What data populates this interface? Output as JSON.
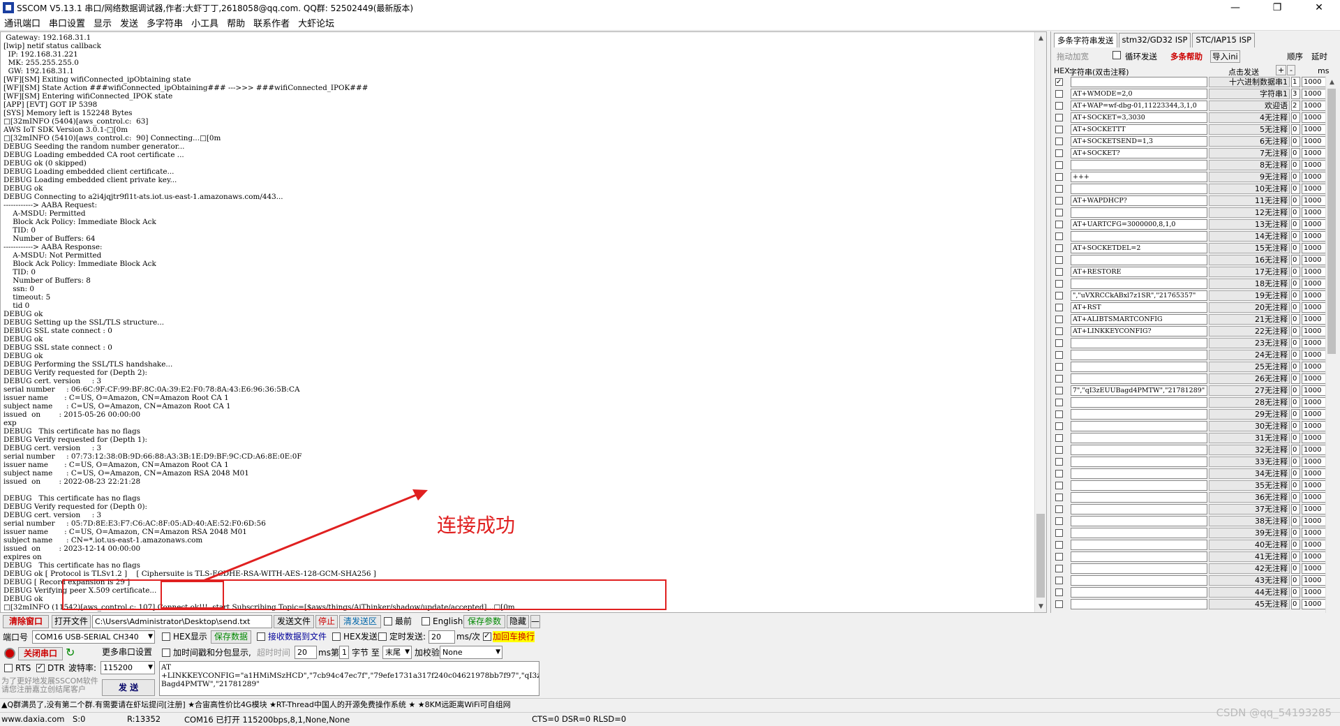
{
  "window": {
    "title": "SSCOM V5.13.1 串口/网络数据调试器,作者:大虾丁丁,2618058@qq.com. QQ群: 52502449(最新版本)",
    "minimize": "—",
    "maximize": "❐",
    "close": "✕"
  },
  "menu": [
    "通讯端口",
    "串口设置",
    "显示",
    "发送",
    "多字符串",
    "小工具",
    "帮助",
    "联系作者",
    "大虾论坛"
  ],
  "log": {
    "text": " Gateway: 192.168.31.1\n[lwip] netif status callback\n  IP: 192.168.31.221\n  MK: 255.255.255.0\n  GW: 192.168.31.1\n[WF][SM] Exiting wifiConnected_ipObtaining state\n[WF][SM] State Action ###wifiConnected_ipObtaining### --->>> ###wifiConnected_IPOK###\n[WF][SM] Entering wifiConnected_IPOK state\n[APP] [EVT] GOT IP 5398\n[SYS] Memory left is 152248 Bytes\n□[32mINFO (5404)[aws_control.c:  63]\nAWS IoT SDK Version 3.0.1-□[0m\n□[32mINFO (5410)[aws_control.c:  90] Connecting...□[0m\nDEBUG Seeding the random number generator...\nDEBUG Loading embedded CA root certificate ...\nDEBUG ok (0 skipped)\nDEBUG Loading embedded client certificate...\nDEBUG Loading embedded client private key...\nDEBUG ok\nDEBUG Connecting to a2i4jqjtr9fl1t-ats.iot.us-east-1.amazonaws.com/443...\n------------> AABA Request:\n    A-MSDU: Permitted\n    Block Ack Policy: Immediate Block Ack\n    TID: 0\n    Number of Buffers: 64\n------------> AABA Response:\n    A-MSDU: Not Permitted\n    Block Ack Policy: Immediate Block Ack\n    TID: 0\n    Number of Buffers: 8\n    ssn: 0\n    timeout: 5\n    tid 0\nDEBUG ok\nDEBUG Setting up the SSL/TLS structure...\nDEBUG SSL state connect : 0\nDEBUG ok\nDEBUG SSL state connect : 0\nDEBUG ok\nDEBUG Performing the SSL/TLS handshake...\nDEBUG Verify requested for (Depth 2):\nDEBUG cert. version     : 3\nserial number     : 06:6C:9F:CF:99:BF:8C:0A:39:E2:F0:78:8A:43:E6:96:36:5B:CA\nissuer name       : C=US, O=Amazon, CN=Amazon Root CA 1\nsubject name      : C=US, O=Amazon, CN=Amazon Root CA 1\nissued  on        : 2015-05-26 00:00:00\nexp\nDEBUG   This certificate has no flags\nDEBUG Verify requested for (Depth 1):\nDEBUG cert. version     : 3\nserial number     : 07:73:12:38:0B:9D:66:88:A3:3B:1E:D9:BF:9C:CD:A6:8E:0E:0F\nissuer name       : C=US, O=Amazon, CN=Amazon Root CA 1\nsubject name      : C=US, O=Amazon, CN=Amazon RSA 2048 M01\nissued  on        : 2022-08-23 22:21:28\n\nDEBUG   This certificate has no flags\nDEBUG Verify requested for (Depth 0):\nDEBUG cert. version     : 3\nserial number     : 05:7D:8E:E3:F7:C6:AC:8F:05:AD:40:AE:52:F0:6D:56\nissuer name       : C=US, O=Amazon, CN=Amazon RSA 2048 M01\nsubject name      : CN=*.iot.us-east-1.amazonaws.com\nissued  on        : 2023-12-14 00:00:00\nexpires on\nDEBUG   This certificate has no flags\nDEBUG ok [ Protocol is TLSv1.2 ]    [ Ciphersuite is TLS-ECDHE-RSA-WITH-AES-128-GCM-SHA256 ]\nDEBUG [ Record expansion is 29 ]\nDEBUG Verifying peer X.509 certificate...\nDEBUG ok\n□[32mINFO (11542)[aws_control.c: 107] Connect ok!!!  start Subscribing Topic=[$aws/things/AiThinker/shadow/update/accepted]...□[0m"
  },
  "annotation": {
    "label": "连接成功"
  },
  "right_panel": {
    "tabs": [
      "多条字符串发送",
      "stm32/GD32 ISP",
      "STC/IAP15 ISP"
    ],
    "toolbar": {
      "drag": "拖动加宽",
      "loop": "循环发送",
      "help": "多条帮助",
      "import": "导入ini",
      "order": "顺序",
      "delay": "延时"
    },
    "header": {
      "hex": "HEX",
      "col": "字符串(双击注释)",
      "click": "点击发送",
      "plus": "+",
      "minus": "-",
      "ms": "ms"
    },
    "rows": [
      {
        "hex": true,
        "cmd": "",
        "btn": "十六进制数据串1",
        "ord": "1",
        "dly": "1000"
      },
      {
        "hex": false,
        "cmd": "AT+WMODE=2,0",
        "btn": "字符串1",
        "ord": "3",
        "dly": "1000"
      },
      {
        "hex": false,
        "cmd": "AT+WAP=wf-dbg-01,11223344,3,1,0",
        "btn": "欢迎语",
        "ord": "2",
        "dly": "1000"
      },
      {
        "hex": false,
        "cmd": "AT+SOCKET=3,3030",
        "btn": "4无注释",
        "ord": "0",
        "dly": "1000"
      },
      {
        "hex": false,
        "cmd": "AT+SOCKETTT",
        "btn": "5无注释",
        "ord": "0",
        "dly": "1000"
      },
      {
        "hex": false,
        "cmd": "AT+SOCKETSEND=1,3",
        "btn": "6无注释",
        "ord": "0",
        "dly": "1000"
      },
      {
        "hex": false,
        "cmd": "AT+SOCKET?",
        "btn": "7无注释",
        "ord": "0",
        "dly": "1000"
      },
      {
        "hex": false,
        "cmd": "",
        "btn": "8无注释",
        "ord": "0",
        "dly": "1000"
      },
      {
        "hex": false,
        "cmd": "+++",
        "btn": "9无注释",
        "ord": "0",
        "dly": "1000"
      },
      {
        "hex": false,
        "cmd": "",
        "btn": "10无注释",
        "ord": "0",
        "dly": "1000"
      },
      {
        "hex": false,
        "cmd": "AT+WAPDHCP?",
        "btn": "11无注释",
        "ord": "0",
        "dly": "1000"
      },
      {
        "hex": false,
        "cmd": "",
        "btn": "12无注释",
        "ord": "0",
        "dly": "1000"
      },
      {
        "hex": false,
        "cmd": "AT+UARTCFG=3000000,8,1,0",
        "btn": "13无注释",
        "ord": "0",
        "dly": "1000"
      },
      {
        "hex": false,
        "cmd": "",
        "btn": "14无注释",
        "ord": "0",
        "dly": "1000"
      },
      {
        "hex": false,
        "cmd": "AT+SOCKETDEL=2",
        "btn": "15无注释",
        "ord": "0",
        "dly": "1000"
      },
      {
        "hex": false,
        "cmd": "",
        "btn": "16无注释",
        "ord": "0",
        "dly": "1000"
      },
      {
        "hex": false,
        "cmd": "AT+RESTORE",
        "btn": "17无注释",
        "ord": "0",
        "dly": "1000"
      },
      {
        "hex": false,
        "cmd": "",
        "btn": "18无注释",
        "ord": "0",
        "dly": "1000"
      },
      {
        "hex": false,
        "cmd": "\",\"uVXRCCkABxl7z1SR\",\"21765357\"",
        "btn": "19无注释",
        "ord": "0",
        "dly": "1000"
      },
      {
        "hex": false,
        "cmd": "AT+RST",
        "btn": "20无注释",
        "ord": "0",
        "dly": "1000"
      },
      {
        "hex": false,
        "cmd": "AT+ALIBTSMARTCONFIG",
        "btn": "21无注释",
        "ord": "0",
        "dly": "1000"
      },
      {
        "hex": false,
        "cmd": "AT+LINKKEYCONFIG?",
        "btn": "22无注释",
        "ord": "0",
        "dly": "1000"
      },
      {
        "hex": false,
        "cmd": "",
        "btn": "23无注释",
        "ord": "0",
        "dly": "1000"
      },
      {
        "hex": false,
        "cmd": "",
        "btn": "24无注释",
        "ord": "0",
        "dly": "1000"
      },
      {
        "hex": false,
        "cmd": "",
        "btn": "25无注释",
        "ord": "0",
        "dly": "1000"
      },
      {
        "hex": false,
        "cmd": "",
        "btn": "26无注释",
        "ord": "0",
        "dly": "1000"
      },
      {
        "hex": false,
        "cmd": "7\",\"qI3zEUUBagd4PMTW\",\"21781289\"",
        "btn": "27无注释",
        "ord": "0",
        "dly": "1000"
      },
      {
        "hex": false,
        "cmd": "",
        "btn": "28无注释",
        "ord": "0",
        "dly": "1000"
      },
      {
        "hex": false,
        "cmd": "",
        "btn": "29无注释",
        "ord": "0",
        "dly": "1000"
      },
      {
        "hex": false,
        "cmd": "",
        "btn": "30无注释",
        "ord": "0",
        "dly": "1000"
      },
      {
        "hex": false,
        "cmd": "",
        "btn": "31无注释",
        "ord": "0",
        "dly": "1000"
      },
      {
        "hex": false,
        "cmd": "",
        "btn": "32无注释",
        "ord": "0",
        "dly": "1000"
      },
      {
        "hex": false,
        "cmd": "",
        "btn": "33无注释",
        "ord": "0",
        "dly": "1000"
      },
      {
        "hex": false,
        "cmd": "",
        "btn": "34无注释",
        "ord": "0",
        "dly": "1000"
      },
      {
        "hex": false,
        "cmd": "",
        "btn": "35无注释",
        "ord": "0",
        "dly": "1000"
      },
      {
        "hex": false,
        "cmd": "",
        "btn": "36无注释",
        "ord": "0",
        "dly": "1000"
      },
      {
        "hex": false,
        "cmd": "",
        "btn": "37无注释",
        "ord": "0",
        "dly": "1000"
      },
      {
        "hex": false,
        "cmd": "",
        "btn": "38无注释",
        "ord": "0",
        "dly": "1000"
      },
      {
        "hex": false,
        "cmd": "",
        "btn": "39无注释",
        "ord": "0",
        "dly": "1000"
      },
      {
        "hex": false,
        "cmd": "",
        "btn": "40无注释",
        "ord": "0",
        "dly": "1000"
      },
      {
        "hex": false,
        "cmd": "",
        "btn": "41无注释",
        "ord": "0",
        "dly": "1000"
      },
      {
        "hex": false,
        "cmd": "",
        "btn": "42无注释",
        "ord": "0",
        "dly": "1000"
      },
      {
        "hex": false,
        "cmd": "",
        "btn": "43无注释",
        "ord": "0",
        "dly": "1000"
      },
      {
        "hex": false,
        "cmd": "",
        "btn": "44无注释",
        "ord": "0",
        "dly": "1000"
      },
      {
        "hex": false,
        "cmd": "",
        "btn": "45无注释",
        "ord": "0",
        "dly": "1000"
      }
    ]
  },
  "controls": {
    "clear": "清除窗口",
    "open_file": "打开文件",
    "file_path": "C:\\Users\\Administrator\\Desktop\\send.txt",
    "send_file": "发送文件",
    "stop": "停止",
    "clear_send": "清发送区",
    "topmost": "最前",
    "english": "English",
    "save_params": "保存参数",
    "hide": "隐藏",
    "minus": "—",
    "port_label": "端口号",
    "port_value": "COM16 USB-SERIAL CH340",
    "more_settings": "更多串口设置",
    "hex_display": "HEX显示",
    "save_data": "保存数据",
    "recv_to_file": "接收数据到文件",
    "hex_send": "HEX发送",
    "timed_send": "定时发送:",
    "timed_value": "20",
    "timed_unit": "ms/次",
    "add_crlf": "加回车换行",
    "close_port": "关闭串口",
    "add_timestamp": "加时间戳和分包显示,",
    "timeout_label": "超时时间",
    "timeout_value": "20",
    "ms": "ms",
    "nth": "第",
    "byte_value": "1",
    "byte_label": "字节 至",
    "end_value": "末尾",
    "checksum_label": "加校验",
    "checksum_value": "None",
    "rts": "RTS",
    "dtr": "DTR",
    "baud_label": "波特率:",
    "baud_value": "115200",
    "promo": "为了更好地发展SSCOM软件\n请您注册嘉立创结尾客户",
    "send": "发 送",
    "send_text": "AT\n+LINKKEYCONFIG=\"a1HMiMSzHCD\",\"7cb94c47ec7f\",\"79efe1731a317f240c04621978bb7f97\",\"qI3zEUU\nBagd4PMTW\",\"21781289\""
  },
  "adbar": "▲Q群满员了,没有第二个群.有需要请在虾坛提问[注册]  ★合宙高性价比4G模块  ★RT-Thread中国人的开源免费操作系统  ★  ★8KM远距离WiFi可自组网",
  "status": {
    "site": "www.daxia.com",
    "s": "S:0",
    "r": "R:13352",
    "port": "COM16 已打开  115200bps,8,1,None,None",
    "lines": "CTS=0 DSR=0 RLSD=0"
  },
  "watermark": "CSDN @qq_54193285"
}
